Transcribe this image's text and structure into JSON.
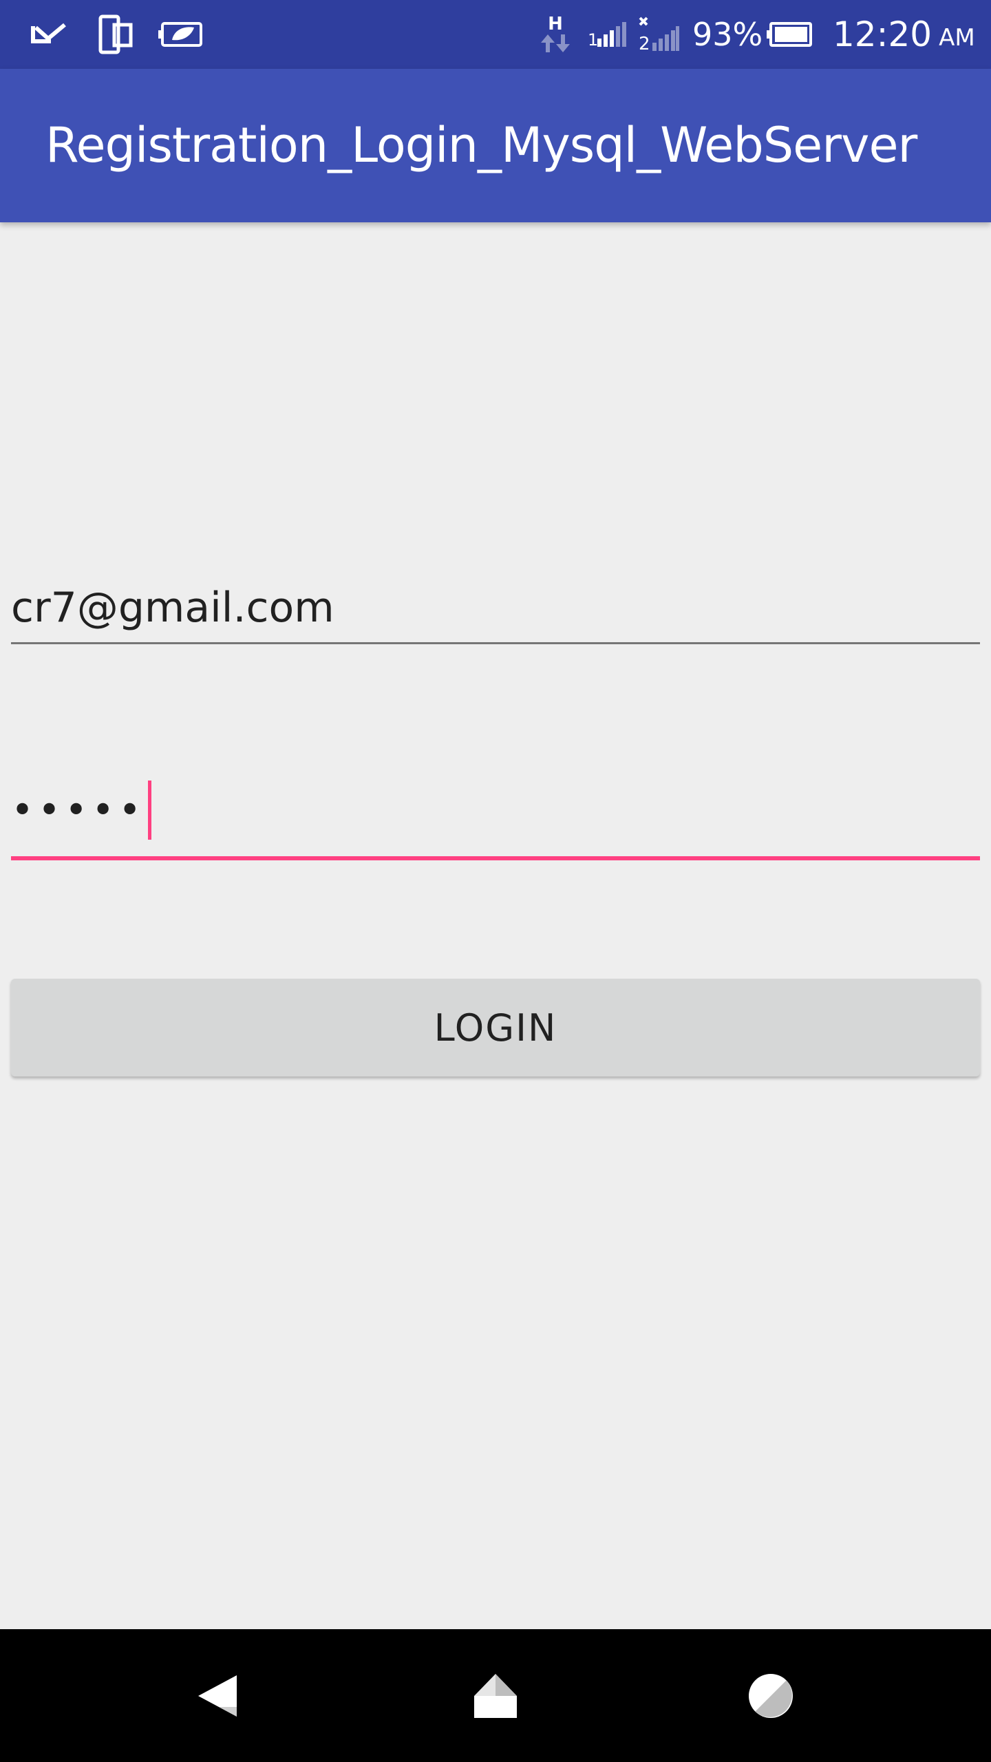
{
  "status_bar": {
    "network_type": "H",
    "sim2_label": "2",
    "battery_percent": "93%",
    "time": "12:20",
    "ampm": "AM",
    "icons": [
      "download-check-icon",
      "phone-screen-icon",
      "battery-saver-icon",
      "data-arrows-icon",
      "signal-icon",
      "signal-no-service-icon",
      "battery-icon"
    ]
  },
  "app_bar": {
    "title": "Registration_Login_Mysql_WebServer",
    "color": "#3f51b5"
  },
  "form": {
    "email_value": "cr7@gmail.com",
    "password_value": "•••••",
    "login_label": "LOGIN",
    "accent_color": "#ff4081"
  },
  "nav_bar": {
    "icons": [
      "back-icon",
      "home-icon",
      "recents-icon"
    ]
  }
}
